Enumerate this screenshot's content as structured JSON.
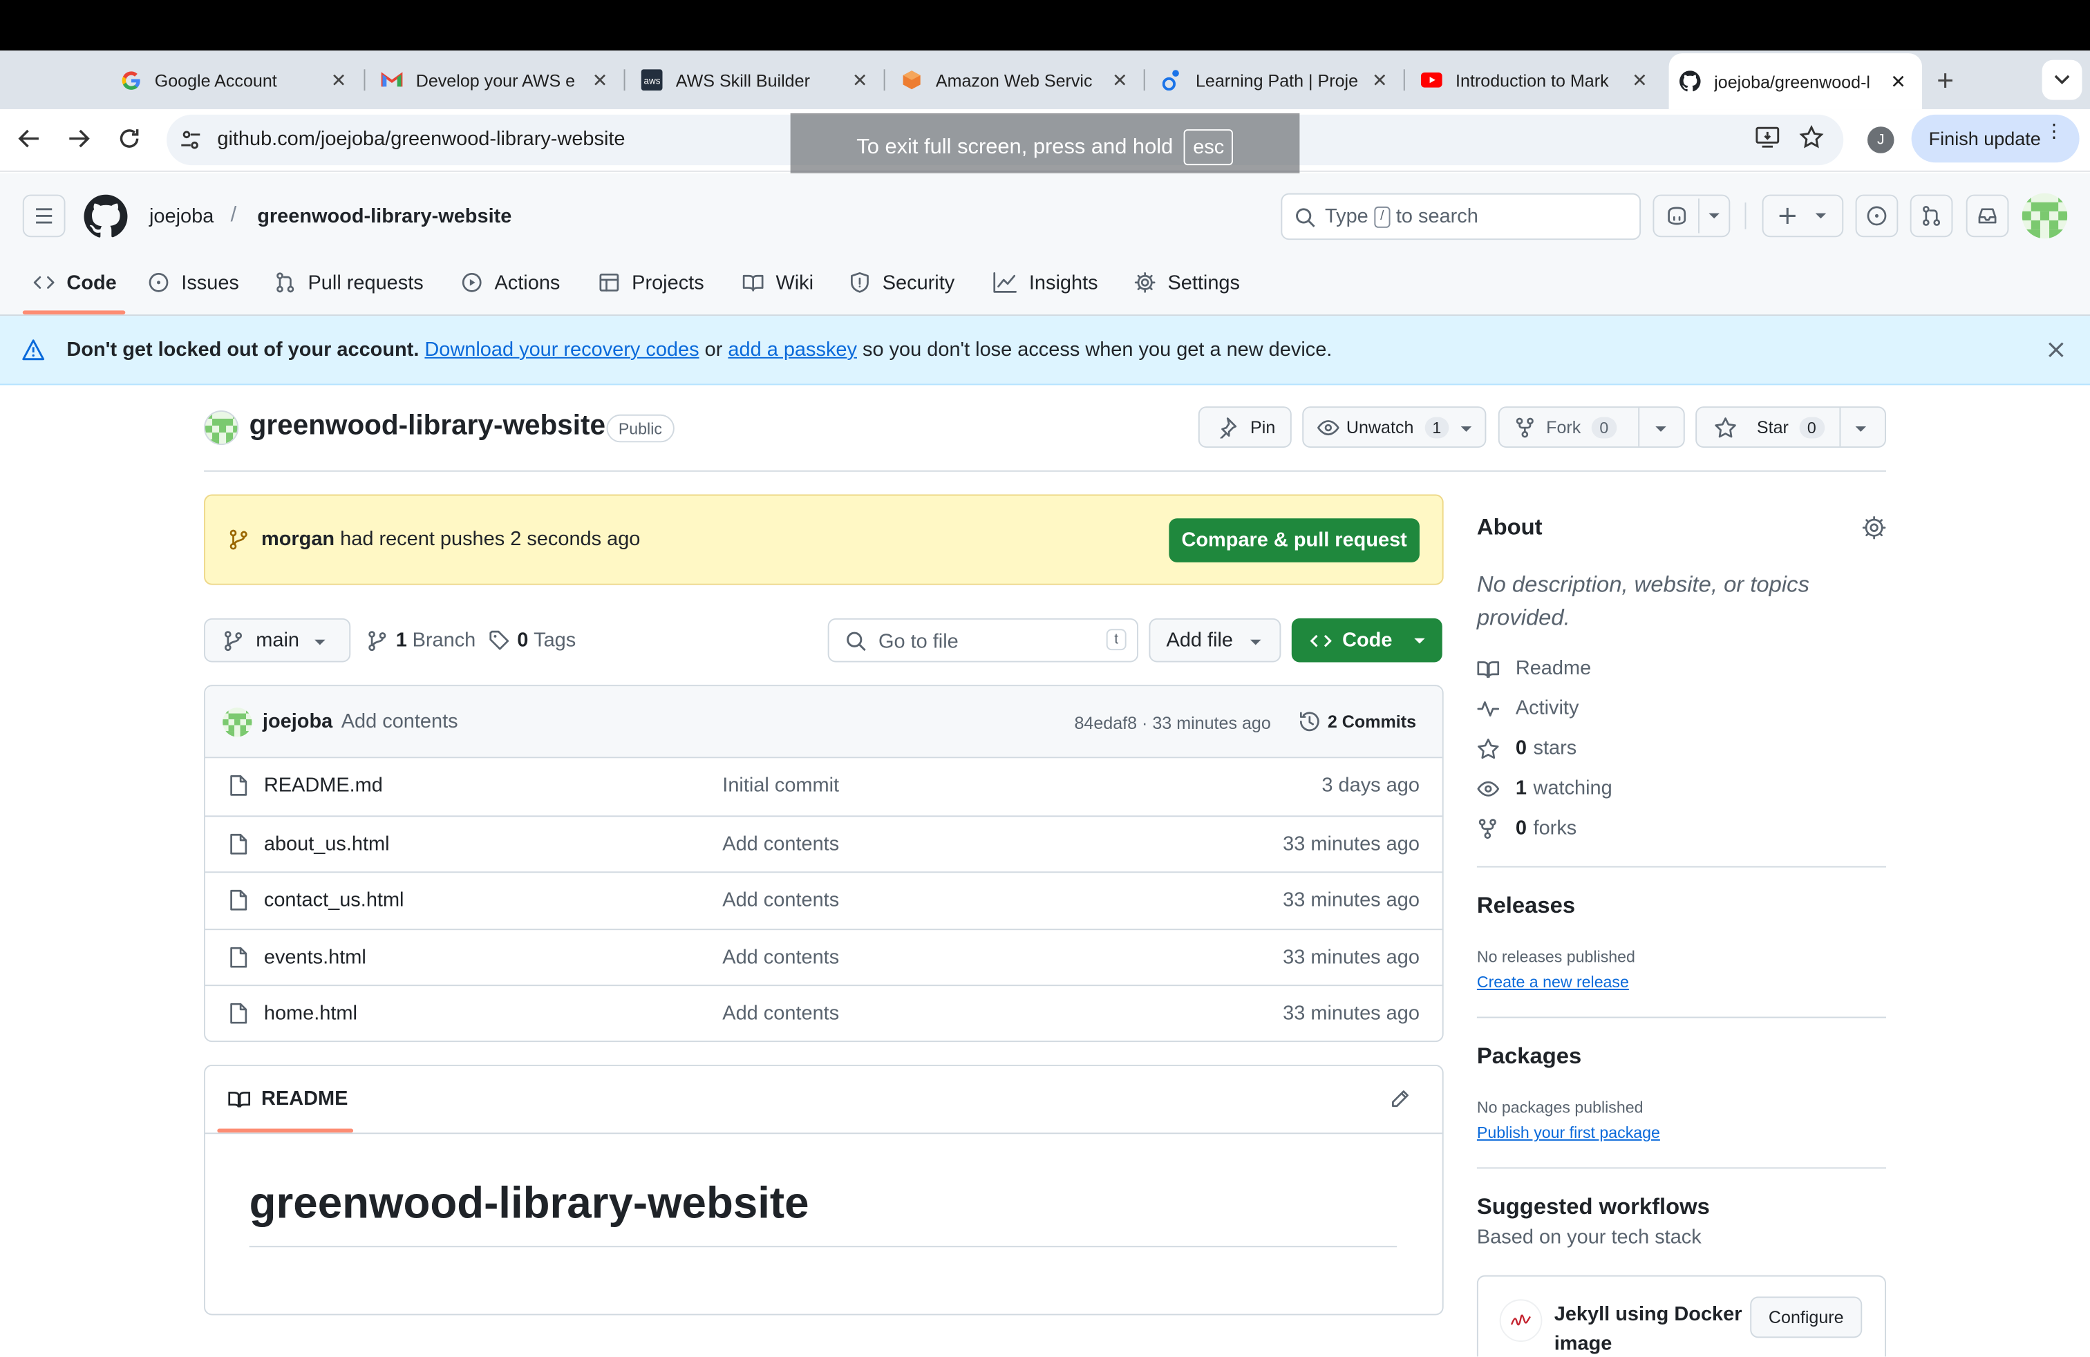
{
  "browser": {
    "tabs": [
      {
        "label": "Google Account",
        "icon": "google-icon"
      },
      {
        "label": "Develop your AWS e",
        "icon": "gmail-icon"
      },
      {
        "label": "AWS Skill Builder",
        "icon": "aws-icon"
      },
      {
        "label": "Amazon Web Servic",
        "icon": "aws-box-icon"
      },
      {
        "label": "Learning Path | Proje",
        "icon": "learning-icon"
      },
      {
        "label": "Introduction to Mark",
        "icon": "youtube-icon"
      },
      {
        "label": "joejoba/greenwood-l",
        "icon": "github-icon"
      }
    ],
    "new_tab": "+",
    "url": "github.com/joejoba/greenwood-library-website",
    "fullscreen_hint": "To exit full screen, press and hold",
    "fullscreen_key": "esc",
    "profile_initial": "J",
    "finish_update": "Finish update"
  },
  "github": {
    "owner": "joejoba",
    "separator": "/",
    "repo": "greenwood-library-website",
    "search_prefix": "Type",
    "search_key": "/",
    "search_suffix": "to search",
    "nav": [
      "Code",
      "Issues",
      "Pull requests",
      "Actions",
      "Projects",
      "Wiki",
      "Security",
      "Insights",
      "Settings"
    ]
  },
  "banner": {
    "bold": "Don't get locked out of your account.",
    "link1": "Download your recovery codes",
    "mid": " or ",
    "link2": "add a passkey",
    "rest": " so you don't lose access when you get a new device."
  },
  "repo": {
    "name": "greenwood-library-website",
    "visibility": "Public",
    "pin": "Pin",
    "unwatch": "Unwatch",
    "watch_count": "1",
    "fork": "Fork",
    "fork_count": "0",
    "star": "Star",
    "star_count": "0",
    "push_user": "morgan",
    "push_text": "had recent pushes 2 seconds ago",
    "compare": "Compare & pull request",
    "branch": "main",
    "branch_count": "1",
    "branch_label": "Branch",
    "tag_count": "0",
    "tag_label": "Tags",
    "goto_placeholder": "Go to file",
    "goto_key": "t",
    "add_file": "Add file",
    "code_btn": "Code",
    "commit_user": "joejoba",
    "commit_msg": "Add contents",
    "commit_meta": "84edaf8 · 33 minutes ago",
    "commits": "2 Commits",
    "files": [
      {
        "name": "README.md",
        "msg": "Initial commit",
        "date": "3 days ago"
      },
      {
        "name": "about_us.html",
        "msg": "Add contents",
        "date": "33 minutes ago"
      },
      {
        "name": "contact_us.html",
        "msg": "Add contents",
        "date": "33 minutes ago"
      },
      {
        "name": "events.html",
        "msg": "Add contents",
        "date": "33 minutes ago"
      },
      {
        "name": "home.html",
        "msg": "Add contents",
        "date": "33 minutes ago"
      }
    ],
    "readme_tab": "README",
    "readme_title": "greenwood-library-website"
  },
  "about": {
    "title": "About",
    "desc": "No description, website, or topics provided.",
    "readme": "Readme",
    "activity": "Activity",
    "stars_n": "0",
    "stars": "stars",
    "watching_n": "1",
    "watching": "watching",
    "forks_n": "0",
    "forks": "forks",
    "releases": "Releases",
    "no_releases": "No releases published",
    "create_release": "Create a new release",
    "packages": "Packages",
    "no_packages": "No packages published",
    "publish_package": "Publish your first package",
    "workflows": "Suggested workflows",
    "workflows_sub": "Based on your tech stack",
    "workflow_name": "Jekyll using Docker image",
    "configure": "Configure"
  }
}
